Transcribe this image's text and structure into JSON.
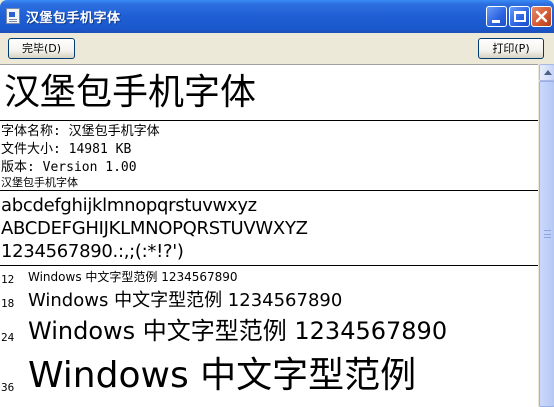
{
  "window": {
    "title": "汉堡包手机字体"
  },
  "toolbar": {
    "done_label": "完毕(D)",
    "print_label": "打印(P)"
  },
  "font": {
    "display_name": "汉堡包手机字体",
    "name_line": "字体名称: 汉堡包手机字体",
    "size_line": "文件大小: 14981 KB",
    "version_line": "版本: Version 1.00",
    "copyright_line": "汉堡包手机字体"
  },
  "samples": {
    "lowercase": "abcdefghijklmnopqrstuvwxyz",
    "uppercase": "ABCDEFGHIJKLMNOPQRSTUVWXYZ",
    "digits": "1234567890.:,;(:*!?')"
  },
  "size_samples": [
    {
      "size": "12",
      "text": "Windows 中文字型范例 1234567890"
    },
    {
      "size": "18",
      "text": "Windows 中文字型范例 1234567890"
    },
    {
      "size": "24",
      "text": "Windows 中文字型范例 1234567890"
    },
    {
      "size": "36",
      "text": "Windows 中文字型范例"
    }
  ],
  "icons": {
    "app": "font-file-icon",
    "minimize": "minimize-icon",
    "maximize": "maximize-icon",
    "close": "close-icon"
  }
}
